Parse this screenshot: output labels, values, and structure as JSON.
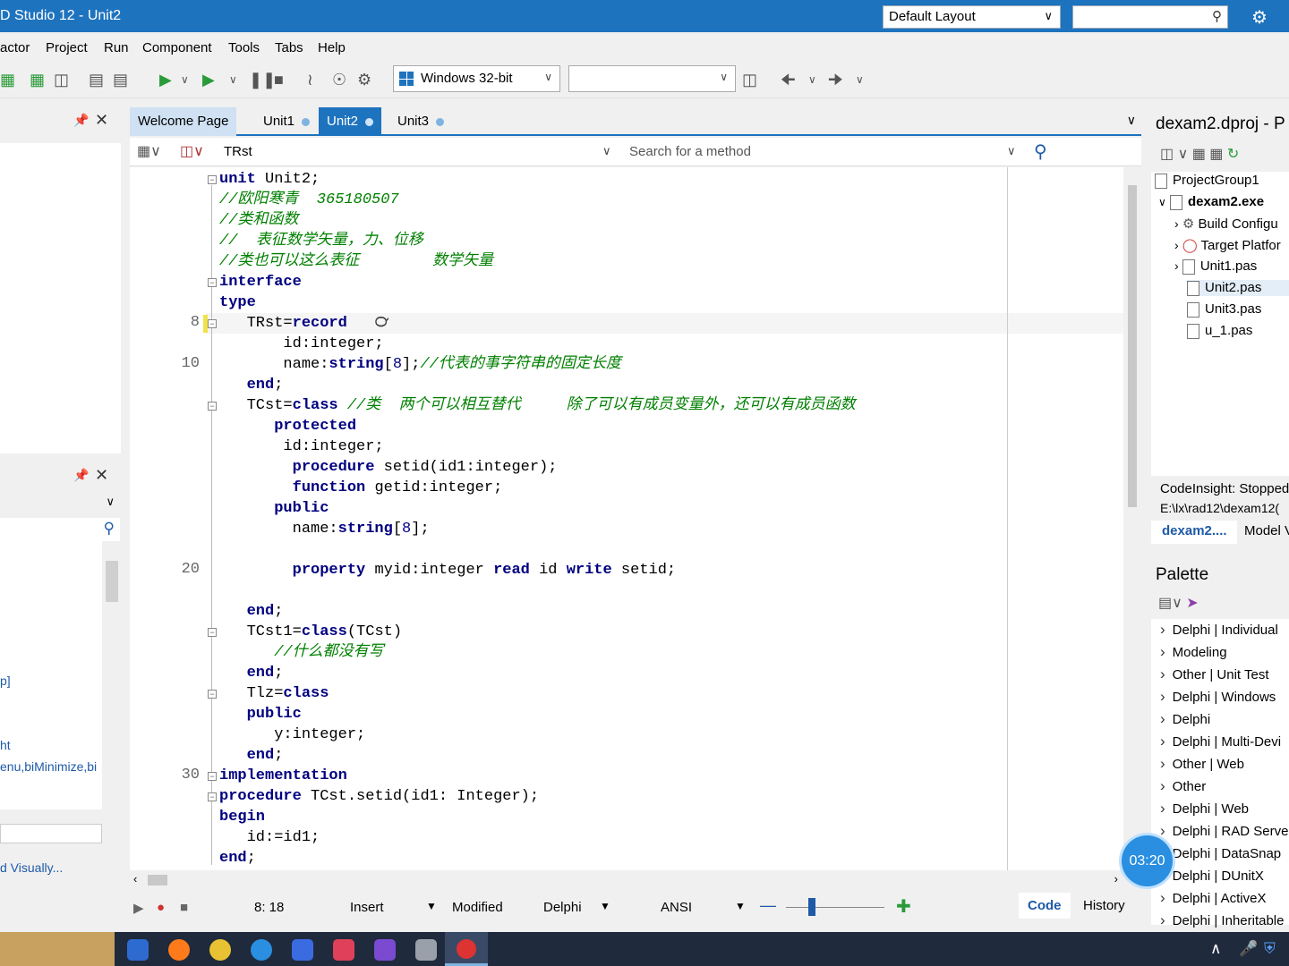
{
  "window": {
    "title": "D Studio 12 - Unit2"
  },
  "header": {
    "layout": "Default Layout"
  },
  "menu": [
    "actor",
    "Project",
    "Run",
    "Component",
    "Tools",
    "Tabs",
    "Help"
  ],
  "toolbar": {
    "platform": "Windows 32-bit"
  },
  "left": {
    "list_items": [
      "p]",
      "ht",
      "enu,biMinimize,bi"
    ],
    "link": "d Visually..."
  },
  "tabs": [
    {
      "label": "Welcome Page"
    },
    {
      "label": "Unit1"
    },
    {
      "label": "Unit2"
    },
    {
      "label": "Unit3"
    }
  ],
  "editor": {
    "class_selector": "TRst",
    "method_search_placeholder": "Search for a method",
    "line_numbers": [
      "8",
      "10",
      "20",
      "30"
    ]
  },
  "status": {
    "position": "8: 18",
    "mode": "Insert",
    "modified": "Modified",
    "language": "Delphi",
    "encoding": "ANSI",
    "tab_code": "Code",
    "tab_history": "History"
  },
  "project": {
    "title": "dexam2.dproj - P",
    "tree": [
      "ProjectGroup1",
      "dexam2.exe",
      "Build Configu",
      "Target Platfor",
      "Unit1.pas",
      "Unit2.pas",
      "Unit3.pas",
      "u_1.pas"
    ],
    "codeinsight": "CodeInsight: Stopped",
    "path": "E:\\lx\\rad12\\dexam12(",
    "bottom_tabs": [
      "dexam2....",
      "Model V"
    ]
  },
  "palette": {
    "title": "Palette",
    "items": [
      "Delphi | Individual",
      "Modeling",
      "Other | Unit Test",
      "Delphi | Windows",
      "Delphi",
      "Delphi | Multi-Devi",
      "Other | Web",
      "Other",
      "Delphi | Web",
      "Delphi | RAD Serve",
      "Delphi | DataSnap",
      "Delphi | DUnitX",
      "Delphi | ActiveX",
      "Delphi | Inheritable"
    ]
  },
  "timer": "03:20"
}
